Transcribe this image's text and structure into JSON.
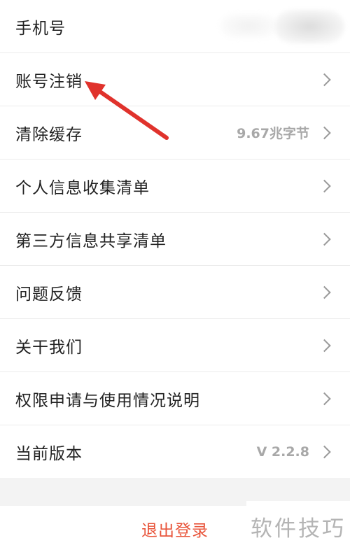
{
  "settings": {
    "items": [
      {
        "label": "手机号",
        "value": "",
        "has_chevron": false
      },
      {
        "label": "账号注销",
        "value": "",
        "has_chevron": true
      },
      {
        "label": "清除缓存",
        "value": "9.67兆字节",
        "has_chevron": true
      },
      {
        "label": "个人信息收集清单",
        "value": "",
        "has_chevron": true
      },
      {
        "label": "第三方信息共享清单",
        "value": "",
        "has_chevron": true
      },
      {
        "label": "问题反馈",
        "value": "",
        "has_chevron": true
      },
      {
        "label": "关干我们",
        "value": "",
        "has_chevron": true
      },
      {
        "label": "权限申请与使用情况说明",
        "value": "",
        "has_chevron": true
      },
      {
        "label": "当前版本",
        "value": "V 2.2.8",
        "has_chevron": true
      }
    ]
  },
  "logout": {
    "label": "退出登录"
  },
  "watermark": {
    "text": "软件技巧"
  },
  "colors": {
    "logout_text": "#e8543a",
    "annotation_arrow": "#e0322c",
    "value_text": "#a8a8a8",
    "separator": "#ececec"
  },
  "icons": {
    "chevron": "chevron-right-icon",
    "annotation": "red-arrow-annotation"
  }
}
